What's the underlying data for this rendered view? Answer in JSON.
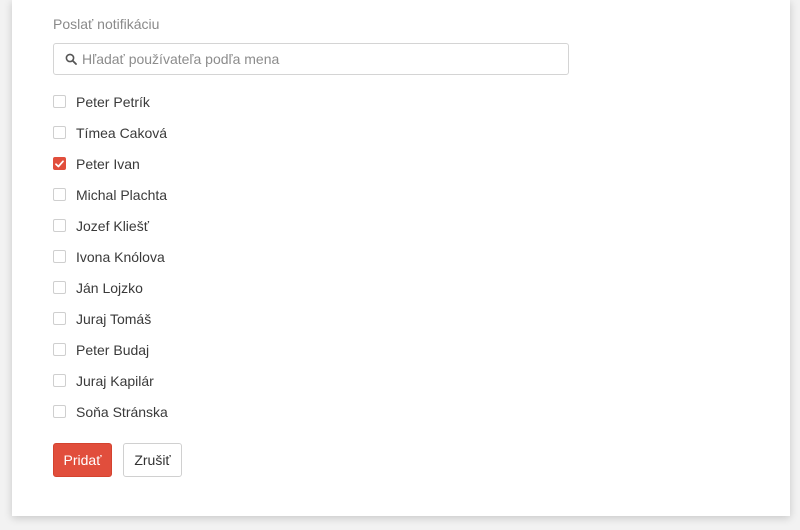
{
  "panel": {
    "title": "Poslať notifikáciu"
  },
  "search": {
    "placeholder": "Hľadať používateľa podľa mena",
    "value": "",
    "icon": "search-icon"
  },
  "users": [
    {
      "name": "Peter Petrík",
      "checked": false
    },
    {
      "name": "Tímea Caková",
      "checked": false
    },
    {
      "name": "Peter Ivan",
      "checked": true
    },
    {
      "name": "Michal Plachta",
      "checked": false
    },
    {
      "name": "Jozef Kliešť",
      "checked": false
    },
    {
      "name": "Ivona Knólova",
      "checked": false
    },
    {
      "name": "Ján Lojzko",
      "checked": false
    },
    {
      "name": "Juraj Tomáš",
      "checked": false
    },
    {
      "name": "Peter Budaj",
      "checked": false
    },
    {
      "name": "Juraj Kapilár",
      "checked": false
    },
    {
      "name": "Soňa Stránska",
      "checked": false
    }
  ],
  "actions": {
    "add_label": "Pridať",
    "cancel_label": "Zrušiť"
  },
  "colors": {
    "accent": "#e14e3c"
  }
}
